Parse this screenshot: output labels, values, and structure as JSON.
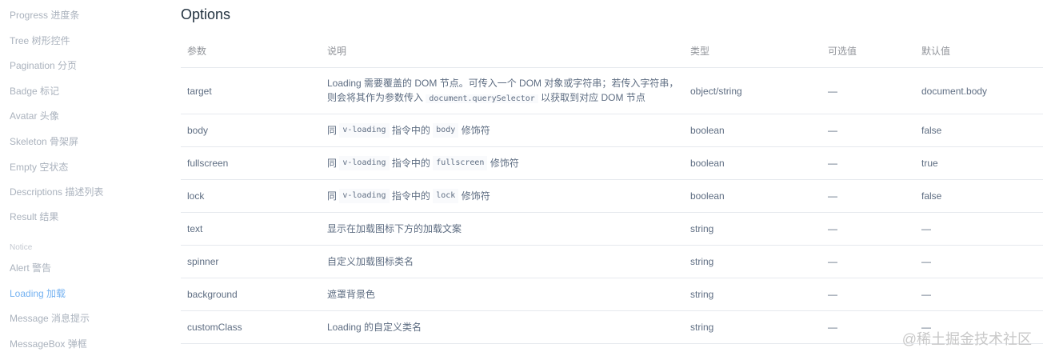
{
  "sidebar": {
    "items": [
      {
        "label": "Progress 进度条"
      },
      {
        "label": "Tree 树形控件"
      },
      {
        "label": "Pagination 分页"
      },
      {
        "label": "Badge 标记"
      },
      {
        "label": "Avatar 头像"
      },
      {
        "label": "Skeleton 骨架屏"
      },
      {
        "label": "Empty 空状态"
      },
      {
        "label": "Descriptions 描述列表"
      },
      {
        "label": "Result 结果"
      }
    ],
    "group_label": "Notice",
    "notice_items": [
      {
        "label": "Alert 警告"
      },
      {
        "label": "Loading 加载",
        "active": true
      },
      {
        "label": "Message 消息提示"
      },
      {
        "label": "MessageBox 弹框"
      }
    ]
  },
  "main": {
    "title": "Options",
    "table": {
      "headers": {
        "param": "参数",
        "desc": "说明",
        "type": "类型",
        "options": "可选值",
        "default": "默认值"
      },
      "rows": [
        {
          "param": "target",
          "desc_pre": "Loading 需要覆盖的 DOM 节点。可传入一个 DOM 对象或字符串；若传入字符串，则会将其作为参数传入",
          "desc_code": "document.querySelector",
          "desc_post": "以获取到对应 DOM 节点",
          "type": "object/string",
          "options": "—",
          "default": "document.body"
        },
        {
          "param": "body",
          "desc_pre": "同",
          "desc_code": "v-loading",
          "desc_mid": "指令中的",
          "desc_code2": "body",
          "desc_post": "修饰符",
          "type": "boolean",
          "options": "—",
          "default": "false"
        },
        {
          "param": "fullscreen",
          "desc_pre": "同",
          "desc_code": "v-loading",
          "desc_mid": "指令中的",
          "desc_code2": "fullscreen",
          "desc_post": "修饰符",
          "type": "boolean",
          "options": "—",
          "default": "true"
        },
        {
          "param": "lock",
          "desc_pre": "同",
          "desc_code": "v-loading",
          "desc_mid": "指令中的",
          "desc_code2": "lock",
          "desc_post": "修饰符",
          "type": "boolean",
          "options": "—",
          "default": "false"
        },
        {
          "param": "text",
          "desc_pre": "显示在加载图标下方的加载文案",
          "type": "string",
          "options": "—",
          "default": "—"
        },
        {
          "param": "spinner",
          "desc_pre": "自定义加载图标类名",
          "type": "string",
          "options": "—",
          "default": "—"
        },
        {
          "param": "background",
          "desc_pre": "遮罩背景色",
          "type": "string",
          "options": "—",
          "default": "—"
        },
        {
          "param": "customClass",
          "desc_pre": "Loading 的自定义类名",
          "type": "string",
          "options": "—",
          "default": "—"
        }
      ]
    }
  },
  "watermark": "@稀土掘金技术社区",
  "colors": {
    "active_nav": "#75b2f1",
    "nav": "#aab2bd",
    "border": "#e6e9ee",
    "title": "#1f2f3d"
  }
}
